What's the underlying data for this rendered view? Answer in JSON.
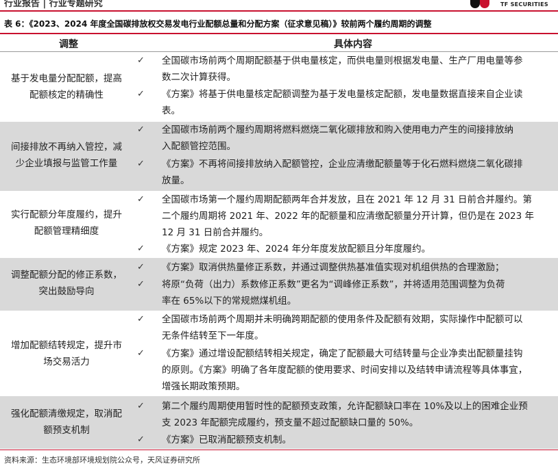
{
  "header": {
    "report_type": "行业报告 | 行业专题研究",
    "brand": "TF SECURITIES"
  },
  "caption": "表 6：《2023、2024 年度全国碳排放权交易发电行业配额总量和分配方案（征求意见稿）》较前两个履约周期的调整",
  "table": {
    "headers": [
      "调整",
      "具体内容"
    ],
    "check_mark": "✓",
    "rows": [
      {
        "label_lines": [
          "基于发电量分配配额，提高",
          "配额核定的精确性"
        ],
        "lines": [
          "全国碳市场前两个周期配额基于供电量核定，而供电量则根据发电量、生产厂用电量等参",
          "数二次计算获得。",
          "《方案》将基于供电量核定配额调整为基于发电量核定配额，发电量数据直接来自企业读",
          "表。"
        ]
      },
      {
        "label_lines": [
          "间接排放不再纳入管控，减",
          "少企业填报与监管工作量"
        ],
        "lines": [
          "全国碳市场前两个履约周期将燃料燃烧二氧化碳排放和购入使用电力产生的间接排放纳",
          "入配额管控范围。",
          "《方案》不再将间接排放纳入配额管控，企业应清缴配额量等于化石燃料燃烧二氧化碳排",
          "放量。"
        ]
      },
      {
        "label_lines": [
          "实行配额分年度履约，提升",
          "配额管理精细度"
        ],
        "lines": [
          "全国碳市场第一个履约周期配额两年合并发放，且在 2021 年 12 月 31 日前合并履约。第",
          "二个履约周期将 2021 年、2022 年的配额量和应清缴配额量分开计算，但仍是在 2023 年",
          "12 月 31 日前合并履约。",
          "《方案》规定 2023 年、2024 年分年度发放配额且分年度履约。"
        ]
      },
      {
        "label_lines": [
          "调整配额分配的修正系数，",
          "突出鼓励导向"
        ],
        "lines": [
          "《方案》取消供热量修正系数，并通过调整供热基准值实现对机组供热的合理激励；",
          "将原“负荷（出力）系数修正系数”更名为“调峰修正系数”，并将适用范围调整为负荷",
          "率在 65%以下的常规燃煤机组。"
        ]
      },
      {
        "label_lines": [
          "增加配额结转规定，提升市",
          "场交易活力"
        ],
        "lines": [
          "全国碳市场前两个周期并未明确跨期配额的使用条件及配额有效期，实际操作中配额可以",
          "无条件结转至下一年度。",
          "《方案》通过增设配额结转相关规定，确定了配额最大可结转量与企业净卖出配额量挂钩",
          "的原则。《方案》明确了各年度配额的使用要求、时间安排以及结转申请流程等具体事宜，",
          "增强长期政策预期。"
        ]
      },
      {
        "label_lines": [
          "强化配额清缴规定，取消配",
          "额预支机制"
        ],
        "lines": [
          "第二个履约周期使用暂时性的配额预支政策，允许配额缺口率在 10%及以上的困难企业预",
          "支 2023 年配额完成履约，预支量不超过配额缺口量的 50%。",
          "《方案》已取消配额预支机制。"
        ]
      }
    ]
  },
  "source": "资料来源：生态环境部环境规划院公众号，天风证券研究所"
}
